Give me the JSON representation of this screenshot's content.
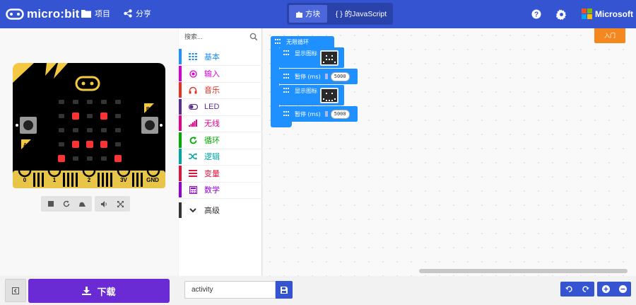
{
  "header": {
    "logo_text": "micro:bit",
    "menu_projects": "项目",
    "menu_share": "分亨",
    "mode_blocks": "方块",
    "mode_js": "{ } 的JavaScript",
    "brand": "Microsoft"
  },
  "simulator": {
    "pins": [
      "0",
      "1",
      "2",
      "3V",
      "GND"
    ],
    "btn_a": "A",
    "btn_b": "B"
  },
  "toolbox": {
    "search_placeholder": "搜索...",
    "categories": [
      {
        "label": "基本",
        "color": "#1e90ff",
        "icon": "grid-icon"
      },
      {
        "label": "输入",
        "color": "#d400d4",
        "icon": "target-icon"
      },
      {
        "label": "音乐",
        "color": "#e63022",
        "icon": "headphones-icon"
      },
      {
        "label": "LED",
        "color": "#5c2d91",
        "icon": "toggle-icon"
      },
      {
        "label": "无线",
        "color": "#e3008c",
        "icon": "signal-icon"
      },
      {
        "label": "循环",
        "color": "#00aa00",
        "icon": "refresh-icon"
      },
      {
        "label": "逻辑",
        "color": "#00a4a6",
        "icon": "shuffle-icon"
      },
      {
        "label": "变量",
        "color": "#dc143c",
        "icon": "list-icon"
      },
      {
        "label": "数学",
        "color": "#9400d3",
        "icon": "calculator-icon"
      }
    ],
    "advanced": "高级"
  },
  "workspace": {
    "tutorial": "入门",
    "forever_label": "无限循环",
    "blocks": [
      {
        "label": "显示图标"
      },
      {
        "label": "暂停 (ms)",
        "value": "5000"
      },
      {
        "label": "显示图标"
      },
      {
        "label": "暂停 (ms)",
        "value": "5000"
      }
    ]
  },
  "footer": {
    "download": "下载",
    "project_name": "activity"
  },
  "colors": {
    "topbar": "#3454d1",
    "download": "#6a2bd4",
    "basic_block": "#1e90ff",
    "tutorial": "#f5871f"
  }
}
